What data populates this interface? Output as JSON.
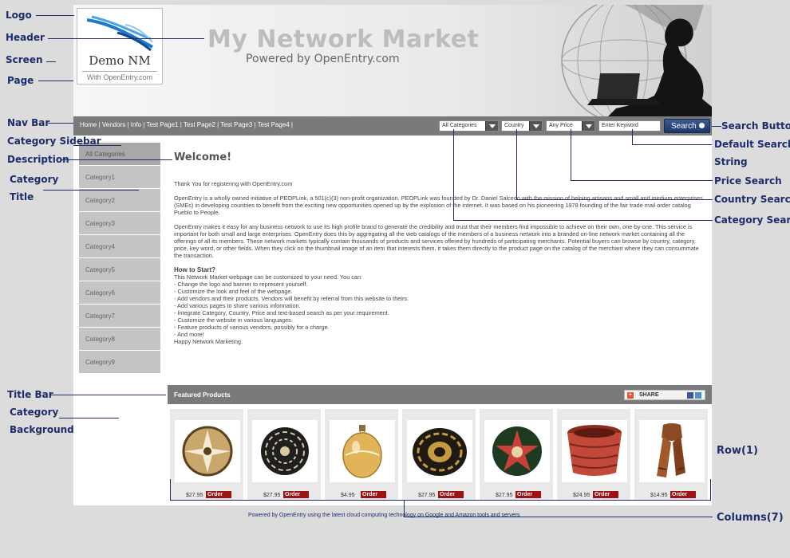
{
  "annotations": {
    "logo": "Logo",
    "header": "Header",
    "screen": "Screen",
    "page": "Page",
    "nav_bar": "Nav Bar",
    "category_sidebar": "Category Sidebar",
    "description": "Description",
    "category_title_1": "Category",
    "category_title_2": "Title",
    "title_bar": "Title Bar",
    "category_background_1": "Category",
    "category_background_2": "Background",
    "search_button": "Search Button",
    "default_search_1": "Default Search",
    "default_search_2": "String",
    "price_search": "Price Search",
    "country_search": "Country Search",
    "category_search": "Category Search",
    "row": "Row(1)",
    "columns": "Columns(7)"
  },
  "logo": {
    "name": "Demo NM",
    "subtitle": "With OpenEntry.com"
  },
  "header": {
    "title": "My Network Market",
    "subtitle": "Powered by OpenEntry.com"
  },
  "nav": {
    "links": "Home | Vendors | Info | Test Page1 | Test Page2 | Test Page3 | Test Page4 |"
  },
  "search": {
    "category": "All Categories",
    "country": "Country",
    "price": "Any Price",
    "keyword": "Enter Keyword",
    "button": "Search"
  },
  "sidebar": {
    "items": [
      {
        "label": "All Categories"
      },
      {
        "label": "Category1"
      },
      {
        "label": "Category2"
      },
      {
        "label": "Category3"
      },
      {
        "label": "Category4"
      },
      {
        "label": "Category5"
      },
      {
        "label": "Category6"
      },
      {
        "label": "Category7"
      },
      {
        "label": "Category8"
      },
      {
        "label": "Category9"
      }
    ]
  },
  "main": {
    "welcome": "Welcome!",
    "thanks": "Thank You for registering with OpenEntry.com",
    "para1": "OpenEntry is a wholly owned initiative of PEOPLink, a 501(c)(3) non-profit organization. PEOPLink was founded by Dr. Daniel Salcedo with the mission of helping artisans and small and medium enterprises (SMEs) in developing countries to benefit from the exciting new opportunities opened up by the explosion of the internet. It was based on his pioneering 1978 founding of the fair trade mail order catalog Pueblo to People.",
    "para2": "OpenEntry makes it easy for any business network to use its high profile brand to generate the credibility and trust that their members find impossible to achieve on their own, one-by-one. This service is important for both small and large enterprises. OpenEntry does this by aggregating all the web catalogs of the members of a business network into a branded on-line network market containing all the offerings of all its members. These network markets typically contain thousands of products and services offered by hundreds of participating merchants. Potential buyers can browse by country, category, price, key word, or other fields. When they click on the thumbnail image of an item that interests them, it takes them directly to the product page on the catalog of the merchant where they can consummate the transaction.",
    "how_title": "How to Start?",
    "how_intro": "This Network Market webpage can be customized to your need. You can:",
    "steps": [
      "- Change the logo and banner to represent yourself.",
      "- Customize the look and feel of the webpage.",
      "- Add vendors and their products. Vendors will benefit by referral from this website to theirs.",
      "- Add various pages to share various information.",
      "- Integrate Category, Country, Price and text-based search as per your requirement.",
      "- Customize the website in various languages.",
      "- Feature products of various vendors, possibly for a charge.",
      "- And more!"
    ],
    "closing": "Happy Network Marketing."
  },
  "featured": {
    "title": "Featured Products",
    "share": "SHARE",
    "order_label": "Order",
    "products": [
      {
        "price": "$27.95",
        "image": "woven-basket-tan"
      },
      {
        "price": "$27.95",
        "image": "woven-basket-black"
      },
      {
        "price": "$4.95",
        "image": "glass-ornament"
      },
      {
        "price": "$27.95",
        "image": "woven-basket-black-gold"
      },
      {
        "price": "$27.95",
        "image": "woven-basket-star"
      },
      {
        "price": "$24.95",
        "image": "red-basket"
      },
      {
        "price": "$14.95",
        "image": "scarf"
      }
    ]
  },
  "footer": "Powered by OpenEntry using the latest cloud computing technology on Google and Amazon tools and servers"
}
